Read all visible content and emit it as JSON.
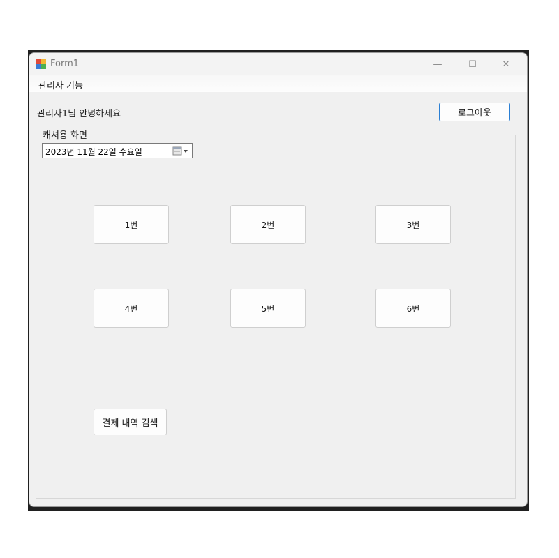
{
  "window": {
    "title": "Form1",
    "controls": {
      "minimize": "—",
      "maximize": "☐",
      "close": "✕"
    }
  },
  "menu": {
    "items": [
      "관리자 기능"
    ]
  },
  "header": {
    "greeting": "관리자1님 안녕하세요",
    "logout_label": "로그아웃"
  },
  "group": {
    "title": "캐셔용 화면",
    "date_value": "2023년 11월 22일 수요일"
  },
  "seats": [
    {
      "label": "1번"
    },
    {
      "label": "2번"
    },
    {
      "label": "3번"
    },
    {
      "label": "4번"
    },
    {
      "label": "5번"
    },
    {
      "label": "6번"
    }
  ],
  "actions": {
    "search_label": "결제 내역 검색"
  },
  "colors": {
    "window_bg": "#f0f0f0",
    "accent_border": "#2a7fd4",
    "button_bg": "#fdfdfd"
  },
  "icons": {
    "app": "form-app-icon",
    "calendar": "calendar-dropdown-icon"
  }
}
